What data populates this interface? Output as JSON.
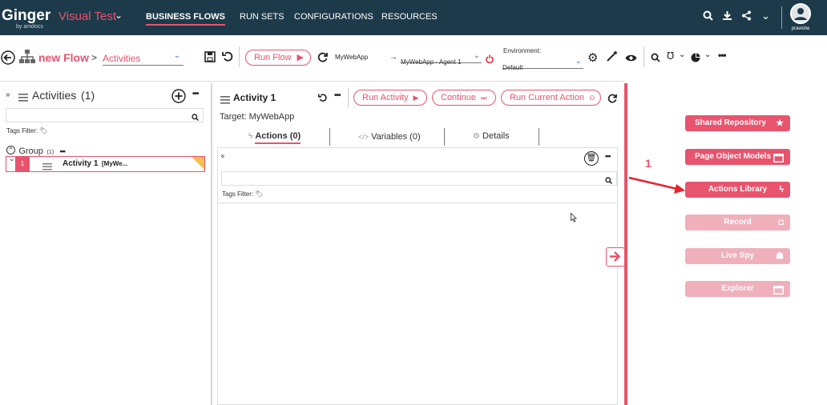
{
  "topbar": {
    "logo": "Ginger",
    "logo_sub": "by amdocs",
    "app_name": "Visual Test",
    "nav": [
      "BUSINESS FLOWS",
      "RUN SETS",
      "CONFIGURATIONS",
      "RESOURCES"
    ],
    "user_name": "pravishe"
  },
  "toolbar": {
    "flow_name": "new Flow",
    "breadcrumb_sep": ">",
    "view_select": "Activities",
    "run_flow": "Run Flow",
    "target_app": "MyWebApp",
    "agent": "MyWebApp - Agent 1",
    "env_label": "Environment:",
    "env_value": "Default"
  },
  "activities_panel": {
    "title": "Activities",
    "count": "(1)",
    "tags_filter": "Tags Filter:",
    "group_name": "Group",
    "group_count": "(1)",
    "activity_num": "1",
    "activity_label": "Activity 1",
    "activity_sub": "[MyWe..."
  },
  "activity_detail": {
    "title": "Activity 1",
    "run_activity": "Run Activity",
    "continue": "Continue",
    "run_current_action": "Run Current Action",
    "target": "Target: MyWebApp",
    "tabs": [
      "Actions (0)",
      "Variables (0)",
      "Details"
    ],
    "tags_filter": "Tags Filter:"
  },
  "right_panel": {
    "callout_number": "1",
    "buttons": [
      {
        "label": "Shared Repository",
        "icon": "star-icon"
      },
      {
        "label": "Page Object Models",
        "icon": "window-icon"
      },
      {
        "label": "Actions Library",
        "icon": "bolt-icon"
      },
      {
        "label": "Record",
        "icon": "camera-icon"
      },
      {
        "label": "Live Spy",
        "icon": "spy-icon"
      },
      {
        "label": "Explorer",
        "icon": "window-icon"
      }
    ]
  },
  "colors": {
    "brand": "#e8546e",
    "topbar": "#1d3a4a"
  }
}
